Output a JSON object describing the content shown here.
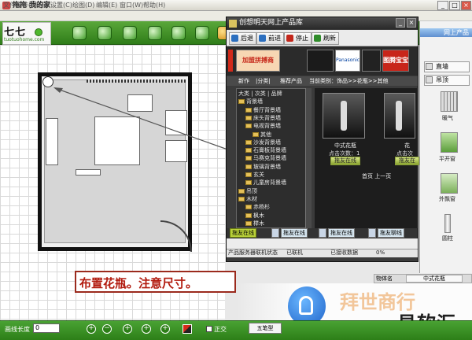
{
  "window": {
    "title": "拖拖 我的家"
  },
  "menu": [
    "文件操作(F)",
    "参数设置(C)",
    "绘图(D)",
    "编辑(E)",
    "窗口(W)",
    "帮助(H)"
  ],
  "logo": {
    "text": "七七",
    "url": "tuotuohome.com"
  },
  "toolbar_icons": [
    "home-icon",
    "book-icon",
    "box-icon",
    "refresh-icon",
    "cycle-icon",
    "check-icon"
  ],
  "product_window": {
    "title": "创想明天网上产品库",
    "nav": [
      "后退",
      "前进",
      "停止",
      "刷新"
    ],
    "banners": [
      "加盟拼搏商",
      "",
      "Panasonic",
      "",
      "图腾宝宝"
    ],
    "tabs": [
      "新作",
      "|分类|",
      "推荐产品"
    ],
    "breadcrumb": "当前类别：饰品>>花瓶>>其他",
    "tree": [
      {
        "indent": 0,
        "label": "大类 | 次类 | 品牌"
      },
      {
        "indent": 0,
        "label": "背景墙"
      },
      {
        "indent": 1,
        "label": "餐厅背景墙"
      },
      {
        "indent": 1,
        "label": "床头背景墙"
      },
      {
        "indent": 1,
        "label": "电视背景墙"
      },
      {
        "indent": 2,
        "label": "其他"
      },
      {
        "indent": 1,
        "label": "沙发背景墙"
      },
      {
        "indent": 1,
        "label": "石膏板背景墙"
      },
      {
        "indent": 1,
        "label": "马赛克背景墙"
      },
      {
        "indent": 1,
        "label": "玻璃背景墙"
      },
      {
        "indent": 1,
        "label": "玄关"
      },
      {
        "indent": 1,
        "label": "儿童房背景墙"
      },
      {
        "indent": 0,
        "label": "吊顶"
      },
      {
        "indent": 0,
        "label": "木材"
      },
      {
        "indent": 1,
        "label": "赤杨杉"
      },
      {
        "indent": 1,
        "label": "枫木"
      },
      {
        "indent": 1,
        "label": "榉木"
      }
    ],
    "products": [
      {
        "name": "中式花瓶",
        "clicks": "点击次数：1",
        "button": "拖友在线"
      },
      {
        "name": "花",
        "clicks": "点击次",
        "button": "拖友在"
      }
    ],
    "pager": "首页  上一页",
    "user_row": [
      "拖友在线",
      "拖友在线",
      "拖友在线",
      "拖友聊线"
    ],
    "status": [
      "产品服务器联机状态",
      "已联机",
      "已接收数据",
      "0%"
    ]
  },
  "right_panel": {
    "title": "网上产品",
    "buttons": [
      "直墙",
      "吊顶"
    ],
    "items": [
      "暖气",
      "平开窗",
      "外飘窗",
      "圆柱"
    ]
  },
  "props": {
    "key": "物体名",
    "value": "中式花瓶"
  },
  "caption": "布置花瓶。注意尺寸。",
  "statusbar": {
    "label": "画线长度",
    "value": "0",
    "check_label": "正交",
    "ime": "五笔型"
  },
  "watermark": {
    "faint": "拜世商行",
    "brand": "易软汇"
  }
}
